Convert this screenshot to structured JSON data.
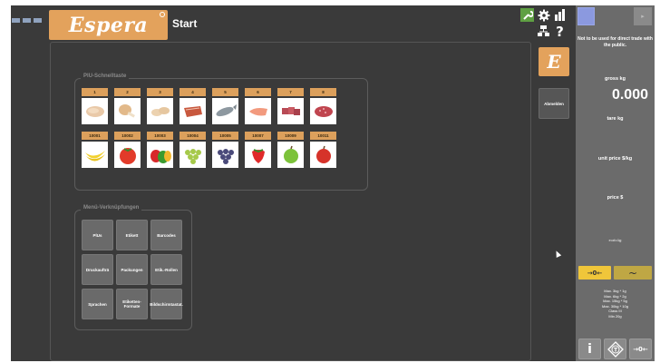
{
  "header": {
    "title": "Start",
    "logo_text": "Espera"
  },
  "plu_group": {
    "title": "PlU-Schnelltaste",
    "items": [
      {
        "num": "1",
        "image": "chicken-breast"
      },
      {
        "num": "2",
        "image": "chicken-leg"
      },
      {
        "num": "3",
        "image": "chicken-wings"
      },
      {
        "num": "4",
        "image": "steak"
      },
      {
        "num": "5",
        "image": "fish"
      },
      {
        "num": "6",
        "image": "salmon-fillet"
      },
      {
        "num": "7",
        "image": "meat-cubes"
      },
      {
        "num": "8",
        "image": "minced-meat"
      },
      {
        "num": "10001",
        "image": "bananas"
      },
      {
        "num": "10002",
        "image": "tomato"
      },
      {
        "num": "10003",
        "image": "bell-peppers"
      },
      {
        "num": "10004",
        "image": "green-grapes"
      },
      {
        "num": "10005",
        "image": "blue-grapes"
      },
      {
        "num": "10007",
        "image": "strawberry"
      },
      {
        "num": "10009",
        "image": "green-apple"
      },
      {
        "num": "10011",
        "image": "red-apple"
      }
    ]
  },
  "menu_group": {
    "title": "Menü-Verknüpfungen",
    "buttons": [
      "PlUs",
      "Etikett",
      "Barcodes",
      "Druckaufträ",
      "Packungen",
      "Etik.-Rollen",
      "Sprachen",
      "Etiketten-Formate",
      "Bildschirmtastat."
    ]
  },
  "side": {
    "e_button": "E",
    "logout_label": "Abmelden"
  },
  "scale": {
    "warning": "Not to be used for direct trade with the public.",
    "gross_label": "gross kg",
    "gross_value": "0.000",
    "tare_label": "tare kg",
    "unit_price_label": "unit price $/kg",
    "price_label": "price $",
    "e_label": "e=d=1g",
    "zero_label": "→0←",
    "tilde_label": "~",
    "specs": [
      "Max. 3kg * 1g",
      "Max. 6kg * 2g",
      "Max. 15kg * 5g",
      "Max. 30kg * 10g",
      "Class III",
      "Min 20g"
    ],
    "info_label": "i",
    "tare_button_label": "T",
    "zero_button_label": "→0←"
  },
  "colors": {
    "accent": "#e3a25c",
    "panel": "#6b6b6b",
    "background": "#3a3a3a"
  }
}
